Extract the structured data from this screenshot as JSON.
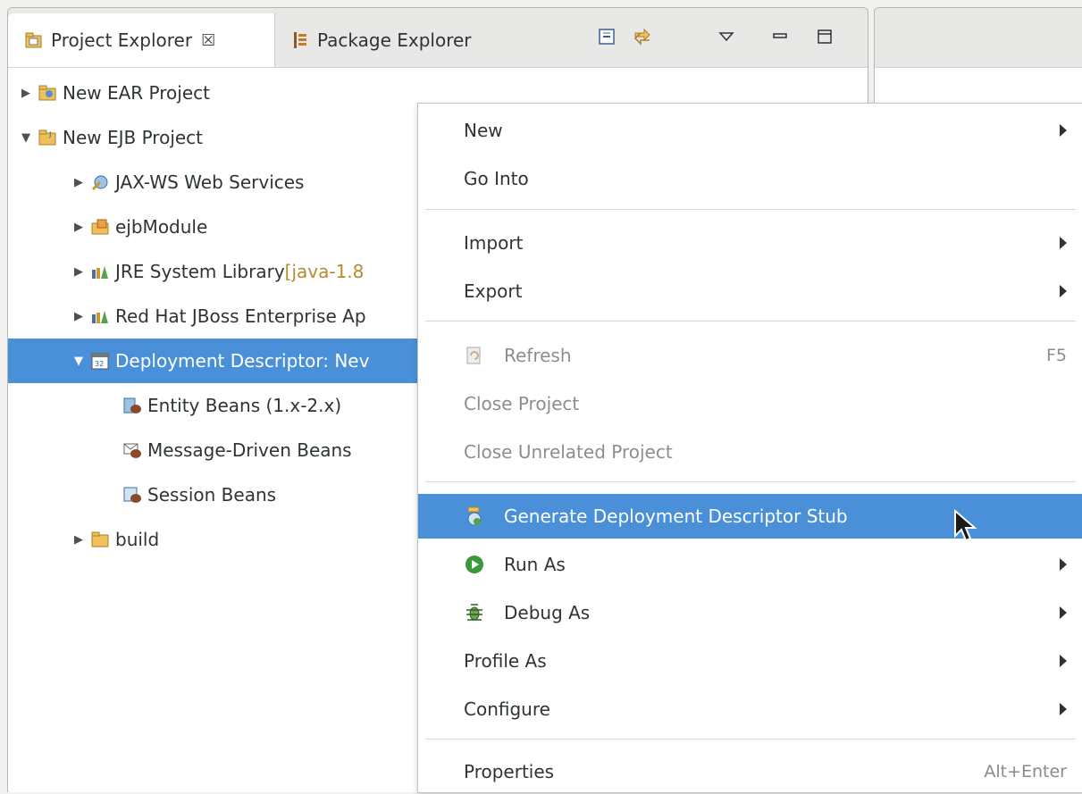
{
  "tabs": {
    "project_explorer": "Project Explorer",
    "project_explorer_close": "☒",
    "package_explorer": "Package Explorer"
  },
  "tree": [
    {
      "label": "New EAR Project",
      "arrow": "▶"
    },
    {
      "label": "New EJB Project",
      "arrow": "▼"
    },
    {
      "label": "JAX-WS Web Services",
      "arrow": "▶"
    },
    {
      "label": "ejbModule",
      "arrow": "▶"
    },
    {
      "label": "JRE System Library ",
      "decoration": "[java-1.8",
      "arrow": "▶"
    },
    {
      "label": "Red Hat JBoss Enterprise Ap",
      "arrow": "▶"
    },
    {
      "label": "Deployment Descriptor: Nev",
      "arrow": "▼"
    },
    {
      "label": "Entity Beans (1.x-2.x)"
    },
    {
      "label": "Message-Driven Beans"
    },
    {
      "label": "Session Beans"
    },
    {
      "label": "build",
      "arrow": "▶"
    }
  ],
  "menu": {
    "new": "New",
    "go_into": "Go Into",
    "import": "Import",
    "export": "Export",
    "refresh": "Refresh",
    "refresh_shortcut": "F5",
    "close_project": "Close Project",
    "close_unrelated_project": "Close Unrelated Project",
    "generate_dd_stub": "Generate Deployment Descriptor Stub",
    "run_as": "Run As",
    "debug_as": "Debug As",
    "profile_as": "Profile As",
    "configure": "Configure",
    "properties": "Properties",
    "properties_shortcut": "Alt+Enter"
  },
  "colors": {
    "selection": "#4a90d9",
    "decoration": "#b58a32"
  }
}
